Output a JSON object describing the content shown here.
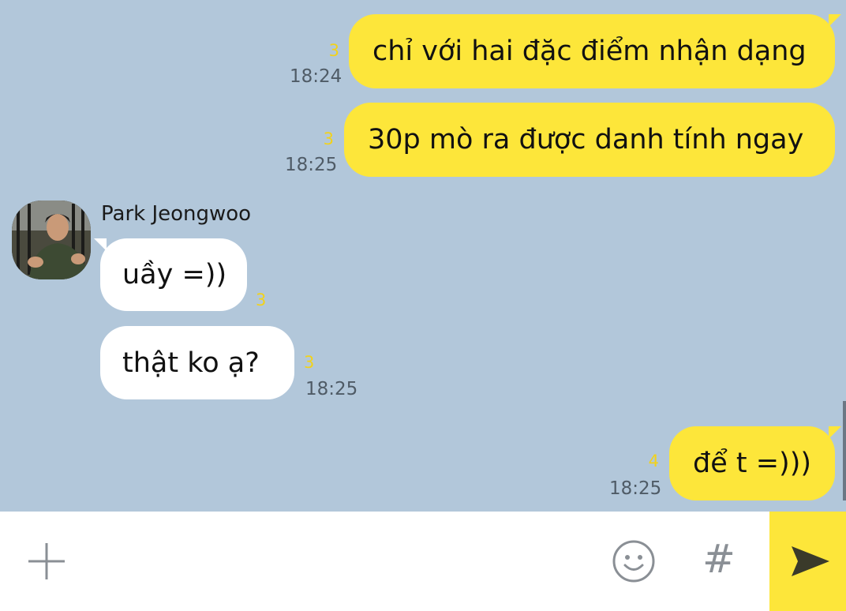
{
  "messages": [
    {
      "sender": "me",
      "text": "chỉ với hai đặc điểm nhận dạng",
      "unread": "3",
      "time": "18:24"
    },
    {
      "sender": "me",
      "text": "30p mò ra được danh tính ngay",
      "unread": "3",
      "time": "18:25"
    },
    {
      "sender": "other",
      "name": "Park Jeongwoo",
      "text": "uầy =))",
      "unread": "3",
      "time": ""
    },
    {
      "sender": "other",
      "text": "thật ko ạ?",
      "unread": "3",
      "time": "18:25"
    },
    {
      "sender": "me",
      "text": "để t =)))",
      "unread": "4",
      "time": "18:25"
    }
  ],
  "contact": {
    "name": "Park Jeongwoo"
  },
  "input": {
    "plus": "plus-icon",
    "emoji": "emoji-icon",
    "hash": "#",
    "send": "send-icon"
  },
  "colors": {
    "background": "#b2c7da",
    "my_bubble": "#fde63a",
    "their_bubble": "#ffffff",
    "unread": "#f2d21a",
    "send_button": "#fde63a"
  }
}
